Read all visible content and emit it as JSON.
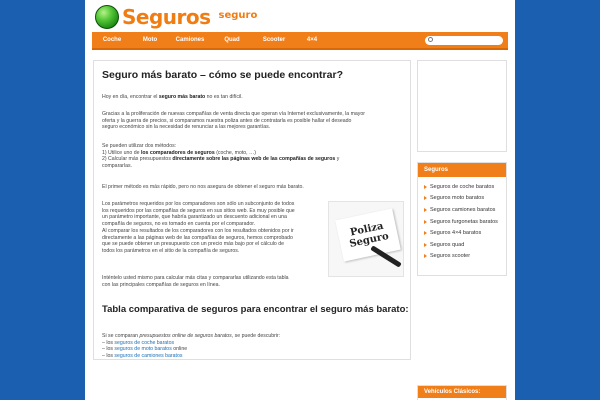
{
  "header": {
    "logo_text": "Seguros",
    "tagline": "seguro"
  },
  "nav": {
    "items": [
      "Coche",
      "Moto",
      "Camiones",
      "Quad",
      "Scooter",
      "4×4"
    ],
    "search_placeholder": ""
  },
  "article": {
    "title": "Seguro más barato – cómo se puede encontrar?",
    "intro_pre": "Hoy en día, encontrar el ",
    "intro_bold": "seguro más barato",
    "intro_post": " no es tan difícil.",
    "p2_l1": "Gracias a la proliferación de nuevas compañías de venta directa que operan vía Internet exclusivamente, la mayor",
    "p2_l2": "oferta y la guerra de precios, si comparamos nuestra poliza antes de contratarla es posible hallar el deseado",
    "p2_l3": "seguro económico sin la necesidad de renunciar a las mejores garantías.",
    "methods_intro": "Se pueden utilizar dos métodos:",
    "m1_pre": "1) Utilice uno de ",
    "m1_bold": "los comparadores de seguros",
    "m1_post": " (coche, moto, …)",
    "m2_pre": "2) Calcular más presupuestos ",
    "m2_bold": "directamente sobre las páginas web de las compañías de seguros",
    "m2_post": " y",
    "m2_l2": "compararlas.",
    "p4": "El primer método es más rápido, pero no nos asegura de obtener el seguro más barato.",
    "p5_lines": [
      "Los parámetros requeridos por los comparadores son sólo un subconjunto de todos",
      "los requeridos por las compañías de seguros en sus sitios web. Es muy posible que",
      "un parámetro importante, que habría garantizado un descuento adicional en una",
      "compañía de seguros, no es tomado en cuenta por el comparador.",
      "Al comparar los resultados de los comparadores con los resultados obtenidos por ir",
      "directamente a las páginas web de las compañías de seguros, hemos comprobado",
      "que se puede obtener un presupuesto con un precio más bajo por el cálculo de",
      "todos los parámetros en el sitio de la compañía de seguros."
    ],
    "p6_l1": "Inténtelo usted mismo para calcular más citas y compararlas utilizando esta tabla",
    "p6_l2": "con las principales compañías de seguros en línea.",
    "image_text_1": "Poliza",
    "image_text_2": "Seguro",
    "subtitle": "Tabla comparativa de seguros para encontrar el seguro más barato:",
    "compare_pre": "Si se comparan ",
    "compare_em": "presupuestos online de seguros baratos",
    "compare_post": ", se puede descubrir:",
    "links": [
      {
        "prefix": "– los ",
        "link": "seguros de coche baratos",
        "suffix": ""
      },
      {
        "prefix": "– los ",
        "link": "seguros de moto baratos",
        "suffix": " online"
      },
      {
        "prefix": "– los ",
        "link": "seguros de camiones baratos",
        "suffix": ""
      }
    ]
  },
  "sidebar": {
    "box_title": "Seguros",
    "items": [
      "Seguros de coche baratos",
      "Seguros moto baratos",
      "Seguros camiones baratos",
      "Seguros furgonetas baratos",
      "Seguros 4×4 baratos",
      "Seguros quad",
      "Seguros scooter"
    ],
    "bottom_title": "Vehículos Clásicos:"
  },
  "colors": {
    "accent": "#f07f1a",
    "background": "#1b5fb0",
    "link": "#1b6fb5"
  }
}
